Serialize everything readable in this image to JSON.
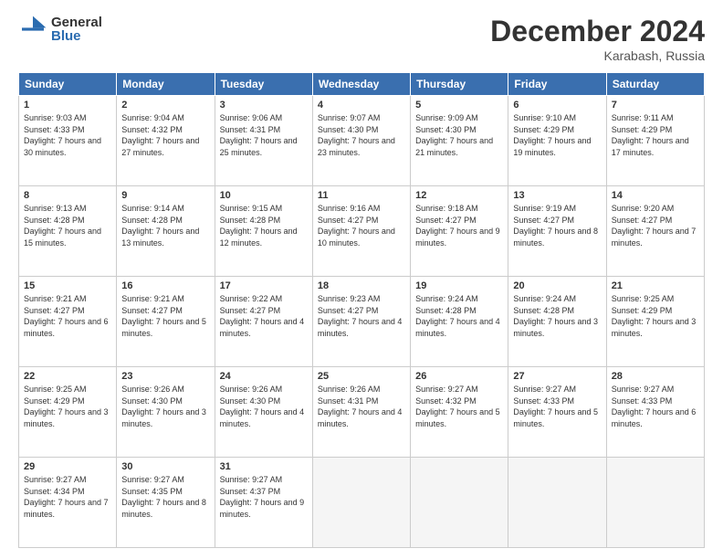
{
  "logo": {
    "general": "General",
    "blue": "Blue"
  },
  "title": "December 2024",
  "subtitle": "Karabash, Russia",
  "headers": [
    "Sunday",
    "Monday",
    "Tuesday",
    "Wednesday",
    "Thursday",
    "Friday",
    "Saturday"
  ],
  "weeks": [
    [
      {
        "day": "1",
        "sunrise": "9:03 AM",
        "sunset": "4:33 PM",
        "daylight": "7 hours and 30 minutes."
      },
      {
        "day": "2",
        "sunrise": "9:04 AM",
        "sunset": "4:32 PM",
        "daylight": "7 hours and 27 minutes."
      },
      {
        "day": "3",
        "sunrise": "9:06 AM",
        "sunset": "4:31 PM",
        "daylight": "7 hours and 25 minutes."
      },
      {
        "day": "4",
        "sunrise": "9:07 AM",
        "sunset": "4:30 PM",
        "daylight": "7 hours and 23 minutes."
      },
      {
        "day": "5",
        "sunrise": "9:09 AM",
        "sunset": "4:30 PM",
        "daylight": "7 hours and 21 minutes."
      },
      {
        "day": "6",
        "sunrise": "9:10 AM",
        "sunset": "4:29 PM",
        "daylight": "7 hours and 19 minutes."
      },
      {
        "day": "7",
        "sunrise": "9:11 AM",
        "sunset": "4:29 PM",
        "daylight": "7 hours and 17 minutes."
      }
    ],
    [
      {
        "day": "8",
        "sunrise": "9:13 AM",
        "sunset": "4:28 PM",
        "daylight": "7 hours and 15 minutes."
      },
      {
        "day": "9",
        "sunrise": "9:14 AM",
        "sunset": "4:28 PM",
        "daylight": "7 hours and 13 minutes."
      },
      {
        "day": "10",
        "sunrise": "9:15 AM",
        "sunset": "4:28 PM",
        "daylight": "7 hours and 12 minutes."
      },
      {
        "day": "11",
        "sunrise": "9:16 AM",
        "sunset": "4:27 PM",
        "daylight": "7 hours and 10 minutes."
      },
      {
        "day": "12",
        "sunrise": "9:18 AM",
        "sunset": "4:27 PM",
        "daylight": "7 hours and 9 minutes."
      },
      {
        "day": "13",
        "sunrise": "9:19 AM",
        "sunset": "4:27 PM",
        "daylight": "7 hours and 8 minutes."
      },
      {
        "day": "14",
        "sunrise": "9:20 AM",
        "sunset": "4:27 PM",
        "daylight": "7 hours and 7 minutes."
      }
    ],
    [
      {
        "day": "15",
        "sunrise": "9:21 AM",
        "sunset": "4:27 PM",
        "daylight": "7 hours and 6 minutes."
      },
      {
        "day": "16",
        "sunrise": "9:21 AM",
        "sunset": "4:27 PM",
        "daylight": "7 hours and 5 minutes."
      },
      {
        "day": "17",
        "sunrise": "9:22 AM",
        "sunset": "4:27 PM",
        "daylight": "7 hours and 4 minutes."
      },
      {
        "day": "18",
        "sunrise": "9:23 AM",
        "sunset": "4:27 PM",
        "daylight": "7 hours and 4 minutes."
      },
      {
        "day": "19",
        "sunrise": "9:24 AM",
        "sunset": "4:28 PM",
        "daylight": "7 hours and 4 minutes."
      },
      {
        "day": "20",
        "sunrise": "9:24 AM",
        "sunset": "4:28 PM",
        "daylight": "7 hours and 3 minutes."
      },
      {
        "day": "21",
        "sunrise": "9:25 AM",
        "sunset": "4:29 PM",
        "daylight": "7 hours and 3 minutes."
      }
    ],
    [
      {
        "day": "22",
        "sunrise": "9:25 AM",
        "sunset": "4:29 PM",
        "daylight": "7 hours and 3 minutes."
      },
      {
        "day": "23",
        "sunrise": "9:26 AM",
        "sunset": "4:30 PM",
        "daylight": "7 hours and 3 minutes."
      },
      {
        "day": "24",
        "sunrise": "9:26 AM",
        "sunset": "4:30 PM",
        "daylight": "7 hours and 4 minutes."
      },
      {
        "day": "25",
        "sunrise": "9:26 AM",
        "sunset": "4:31 PM",
        "daylight": "7 hours and 4 minutes."
      },
      {
        "day": "26",
        "sunrise": "9:27 AM",
        "sunset": "4:32 PM",
        "daylight": "7 hours and 5 minutes."
      },
      {
        "day": "27",
        "sunrise": "9:27 AM",
        "sunset": "4:33 PM",
        "daylight": "7 hours and 5 minutes."
      },
      {
        "day": "28",
        "sunrise": "9:27 AM",
        "sunset": "4:33 PM",
        "daylight": "7 hours and 6 minutes."
      }
    ],
    [
      {
        "day": "29",
        "sunrise": "9:27 AM",
        "sunset": "4:34 PM",
        "daylight": "7 hours and 7 minutes."
      },
      {
        "day": "30",
        "sunrise": "9:27 AM",
        "sunset": "4:35 PM",
        "daylight": "7 hours and 8 minutes."
      },
      {
        "day": "31",
        "sunrise": "9:27 AM",
        "sunset": "4:37 PM",
        "daylight": "7 hours and 9 minutes."
      },
      null,
      null,
      null,
      null
    ]
  ]
}
